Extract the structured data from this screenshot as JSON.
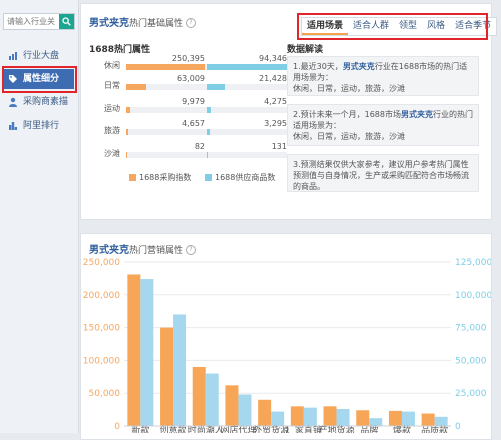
{
  "search": {
    "placeholder": "请输入行业关"
  },
  "sidebar": {
    "items": [
      {
        "label": "行业大盘",
        "icon": "chart-icon",
        "active": false
      },
      {
        "label": "属性细分",
        "icon": "tag-icon",
        "active": true
      },
      {
        "label": "采购商素描",
        "icon": "person-icon",
        "active": false
      },
      {
        "label": "阿里排行",
        "icon": "ranking-icon",
        "active": false
      }
    ]
  },
  "attr_panel": {
    "title_keyword": "男式夹克",
    "title_rest": "热门基础属性",
    "tabs": [
      "适用场景",
      "适合人群",
      "领型",
      "风格",
      "适合季节"
    ],
    "active_tab": "适用场景",
    "section_title": "1688热门属性",
    "rows": [
      {
        "label": "休闲",
        "left": 250395,
        "right": 94346,
        "left_text": "250,395",
        "right_text": "94,346"
      },
      {
        "label": "日常",
        "left": 63009,
        "right": 21428,
        "left_text": "63,009",
        "right_text": "21,428"
      },
      {
        "label": "运动",
        "left": 9979,
        "right": 4275,
        "left_text": "9,979",
        "right_text": "4,275"
      },
      {
        "label": "旅游",
        "left": 4657,
        "right": 3295,
        "left_text": "4,657",
        "right_text": "3,295"
      },
      {
        "label": "沙滩",
        "left": 82,
        "right": 131,
        "left_text": "82",
        "right_text": "131"
      }
    ],
    "legend": {
      "left": "1688采购指数",
      "right": "1688供应商品数"
    },
    "colors": {
      "left": "#f5a760",
      "right": "#7fcee6"
    },
    "interpretation": {
      "title": "数据解读",
      "p1_a": "1.最近30天，",
      "p1_kw": "男式夹克",
      "p1_b": "行业在1688市场的热门适用场景为：",
      "p1_c": "休闲，日常，运动，旅游，沙滩",
      "p2_a": "2.预计未来一个月，1688市场",
      "p2_kw": "男式夹克",
      "p2_b": "行业的热门适用场景为：",
      "p2_c": "休闲，日常，运动，旅游，沙滩",
      "p3": "3.预测结果仅供大家参考，建议用户参考热门属性预测值与自身情况，生产或采购匹配符合市场畅流的商品。"
    }
  },
  "sales_panel": {
    "title_keyword": "男式夹克",
    "title_rest": "热门营销属性"
  },
  "chart_data": {
    "type": "bar",
    "categories": [
      "新款",
      "创意款",
      "时尚潮人",
      "网店代理",
      "外贸货源",
      "厂家直销",
      "产地货源",
      "品牌",
      "爆款",
      "品质款"
    ],
    "series": [
      {
        "values": [
          231000,
          150000,
          90000,
          62000,
          40000,
          30000,
          30000,
          24000,
          23000,
          19000
        ]
      },
      {
        "values": [
          112000,
          85000,
          40000,
          24000,
          11000,
          14000,
          13000,
          6000,
          11000,
          7000
        ]
      }
    ],
    "y_left": {
      "ticks": [
        "250,000",
        "200,000",
        "150,000",
        "100,000",
        "50,000",
        "0"
      ],
      "range": [
        0,
        250000
      ],
      "color": "#f5a760"
    },
    "y_right": {
      "ticks": [
        "125,000",
        "100,000",
        "75,000",
        "50,000",
        "25,000",
        "0"
      ],
      "range": [
        0,
        125000
      ],
      "color": "#7fcee6"
    },
    "colors": [
      "#f7a657",
      "#a5d8ee"
    ],
    "grid": true
  }
}
